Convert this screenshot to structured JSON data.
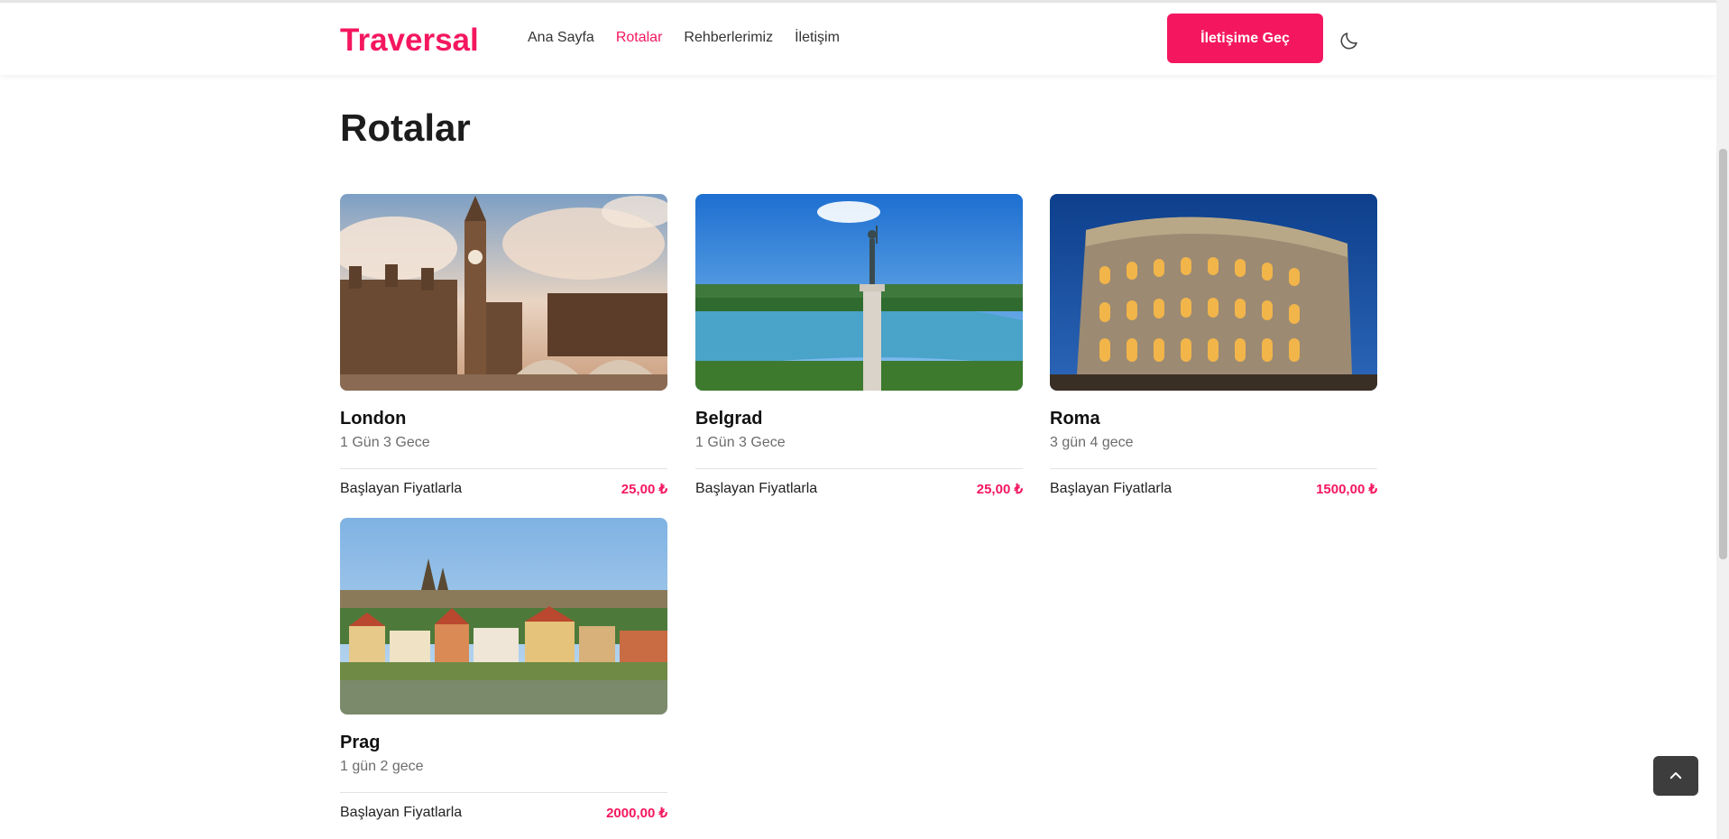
{
  "header": {
    "brand": "Traversal",
    "nav": [
      {
        "label": "Ana Sayfa",
        "active": false
      },
      {
        "label": "Rotalar",
        "active": true
      },
      {
        "label": "Rehberlerimiz",
        "active": false
      },
      {
        "label": "İletişim",
        "active": false
      }
    ],
    "cta_label": "İletişime Geç",
    "theme_icon": "moon-icon"
  },
  "page": {
    "title": "Rotalar"
  },
  "routes": [
    {
      "name": "London",
      "duration": "1 Gün 3 Gece",
      "price_label": "Başlayan Fiyatlarla",
      "price": "25,00 ₺",
      "image": "london-image"
    },
    {
      "name": "Belgrad",
      "duration": "1 Gün 3 Gece",
      "price_label": "Başlayan Fiyatlarla",
      "price": "25,00 ₺",
      "image": "belgrade-image"
    },
    {
      "name": "Roma",
      "duration": "3 gün 4 gece",
      "price_label": "Başlayan Fiyatlarla",
      "price": "1500,00 ₺",
      "image": "rome-image"
    },
    {
      "name": "Prag",
      "duration": "1 gün 2 gece",
      "price_label": "Başlayan Fiyatlarla",
      "price": "2000,00 ₺",
      "image": "prague-image"
    }
  ],
  "colors": {
    "accent": "#f4175f",
    "text": "#1c1c1c",
    "muted": "#6c6c6c",
    "scroll_button": "#3d3d3d"
  },
  "scroll_top_icon": "chevron-up-icon"
}
